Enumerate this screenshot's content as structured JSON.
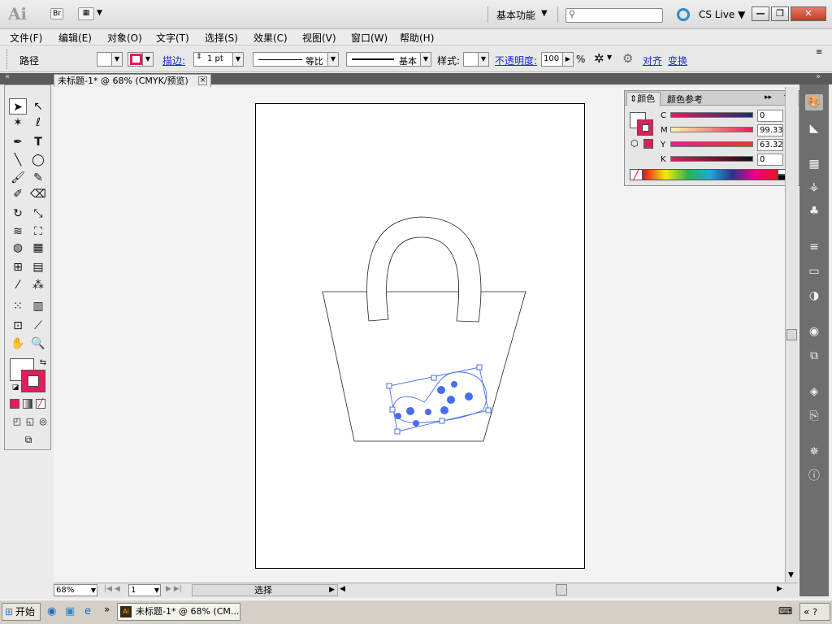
{
  "app": {
    "logo": "Ai",
    "bridge": "Br",
    "workspace": "基本功能",
    "cslive": "CS Live"
  },
  "menu": [
    "文件(F)",
    "编辑(E)",
    "对象(O)",
    "文字(T)",
    "选择(S)",
    "效果(C)",
    "视图(V)",
    "窗口(W)",
    "帮助(H)"
  ],
  "control": {
    "object_type": "路径",
    "stroke_link": "描边:",
    "stroke_weight": "1 pt",
    "profile_label": "等比",
    "brush_label": "基本",
    "style_label": "样式:",
    "opacity_link": "不透明度:",
    "opacity_value": "100",
    "opacity_pct": "%",
    "align_link": "对齐",
    "transform_link": "变换"
  },
  "document_tab": {
    "title": "未标题-1* @ 68% (CMYK/预览)",
    "close": "×"
  },
  "color_panel": {
    "tab_color": "颜色",
    "tab_guide": "颜色参考",
    "sliders": [
      {
        "label": "C",
        "value": "0",
        "pct": "%"
      },
      {
        "label": "M",
        "value": "99.33",
        "pct": "%"
      },
      {
        "label": "Y",
        "value": "63.32",
        "pct": "%"
      },
      {
        "label": "K",
        "value": "0",
        "pct": "%"
      }
    ],
    "accent": "#e01e5a"
  },
  "status": {
    "zoom": "68%",
    "page": "1",
    "mode": "选择"
  },
  "taskbar": {
    "start": "开始",
    "task": "未标题-1* @ 68% (CM..."
  }
}
